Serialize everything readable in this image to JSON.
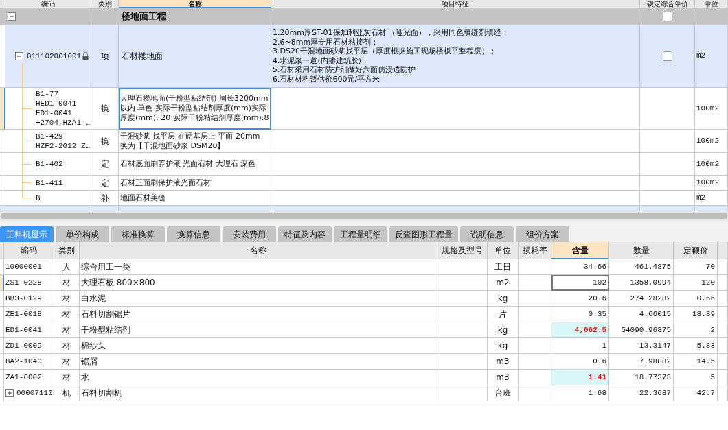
{
  "upper_table": {
    "columns": [
      {
        "label": "编码",
        "selected": false
      },
      {
        "label": "类别",
        "selected": false
      },
      {
        "label": "名称",
        "selected": true
      },
      {
        "label": "项目特征",
        "selected": false
      },
      {
        "label": "锁定综合单价",
        "selected": false
      },
      {
        "label": "单位",
        "selected": false
      }
    ],
    "rows": [
      {
        "kind": "group",
        "expanded": true,
        "name": "楼地面工程",
        "lock_checked": false,
        "children": [
          {
            "kind": "item",
            "code": "011102001001",
            "locked": true,
            "expanded": true,
            "type": "项",
            "name": "石材楼地面",
            "features": [
              "1.20mm厚ST-01保加利亚灰石材 （哑光面），采用同色填缝剂填缝；",
              "2.6~8mm厚专用石材粘接剂；",
              "3.DS20干混地面砂浆找平层（厚度根据施工现场楼板平整程度）；",
              "4.水泥浆一道(内掺建筑胶)；",
              "5.石材采用石材防护剂做好六面仿浸透防护",
              "6.石材材料暂估价600元/平方米"
            ],
            "lock_checked": false,
            "unit": "m2",
            "children": [
              {
                "kind": "sub",
                "code": [
                  "B1-77",
                  "HED1-0041",
                  "ED1-0041",
                  "+2704,HZA1-…"
                ],
                "type": "换",
                "name": "大理石楼地面(干粉型粘结剂) 周长3200mm以内 单色  实际干粉型粘结剂厚度(mm)实际厚度(mm): 20  实际干粉粘结剂厚度(mm):8",
                "unit": "100m2",
                "selected": true
              },
              {
                "kind": "sub",
                "code": [
                  "B1-429",
                  "HZF2-2012 Z…"
                ],
                "type": "换",
                "name": "干混砂浆 找平层 在硬基层上 平面 20mm 换为【干混地面砂浆 DSM20】",
                "unit": "100m2",
                "selected": false
              },
              {
                "kind": "sub",
                "code": [
                  "B1-402"
                ],
                "type": "定",
                "name": "石材底面刷养护液 光面石材 大理石 深色",
                "unit": "100m2",
                "selected": false
              },
              {
                "kind": "sub",
                "code": [
                  "B1-411"
                ],
                "type": "定",
                "name": "石材正面刷保护液光面石材",
                "unit": "100m2",
                "selected": false
              },
              {
                "kind": "sub",
                "code": [
                  "B"
                ],
                "type": "补",
                "name": "地面石材美缝",
                "unit": "m2",
                "selected": false
              }
            ]
          }
        ]
      }
    ]
  },
  "tabs": [
    {
      "label": "工料机显示",
      "selected": true
    },
    {
      "label": "单价构成",
      "selected": false
    },
    {
      "label": "标准换算",
      "selected": false
    },
    {
      "label": "换算信息",
      "selected": false
    },
    {
      "label": "安装费用",
      "selected": false
    },
    {
      "label": "特征及内容",
      "selected": false
    },
    {
      "label": "工程量明细",
      "selected": false
    },
    {
      "label": "反查图形工程量",
      "selected": false
    },
    {
      "label": "说明信息",
      "selected": false
    },
    {
      "label": "组价方案",
      "selected": false
    }
  ],
  "lower_table": {
    "columns": [
      {
        "label": "编码",
        "selected": false
      },
      {
        "label": "类别",
        "selected": false
      },
      {
        "label": "名称",
        "selected": false
      },
      {
        "label": "规格及型号",
        "selected": false
      },
      {
        "label": "单位",
        "selected": false
      },
      {
        "label": "损耗率",
        "selected": false
      },
      {
        "label": "含量",
        "selected": true
      },
      {
        "label": "数量",
        "selected": false
      },
      {
        "label": "定额价",
        "selected": false
      }
    ],
    "rows": [
      {
        "code": "10000001",
        "type": "人",
        "name": "综合用工一类",
        "unit": "工日",
        "content": "34.66",
        "quantity": "461.4875",
        "price": "70",
        "modified": false,
        "selected": false,
        "has_children": false
      },
      {
        "code": "ZS1-0228",
        "type": "材",
        "name": "大理石板 800×800",
        "unit": "m2",
        "content": "102",
        "quantity": "1358.0994",
        "price": "120",
        "modified": false,
        "selected": true,
        "has_children": false
      },
      {
        "code": "BB3-0129",
        "type": "材",
        "name": "白水泥",
        "unit": "kg",
        "content": "20.6",
        "quantity": "274.28282",
        "price": "0.66",
        "modified": false,
        "selected": false,
        "has_children": false
      },
      {
        "code": "ZE1-0018",
        "type": "材",
        "name": "石料切割锯片",
        "unit": "片",
        "content": "0.35",
        "quantity": "4.66015",
        "price": "18.89",
        "modified": false,
        "selected": false,
        "has_children": false
      },
      {
        "code": "ED1-0041",
        "type": "材",
        "name": "干粉型粘结剂",
        "unit": "kg",
        "content": "4,062.5",
        "quantity": "54090.96875",
        "price": "2",
        "modified": true,
        "selected": false,
        "has_children": false
      },
      {
        "code": "ZD1-0009",
        "type": "材",
        "name": "棉纱头",
        "unit": "kg",
        "content": "1",
        "quantity": "13.3147",
        "price": "5.83",
        "modified": false,
        "selected": false,
        "has_children": false
      },
      {
        "code": "BA2-1040",
        "type": "材",
        "name": "锯屑",
        "unit": "m3",
        "content": "0.6",
        "quantity": "7.98882",
        "price": "14.5",
        "modified": false,
        "selected": false,
        "has_children": false
      },
      {
        "code": "ZA1-0002",
        "type": "材",
        "name": "水",
        "unit": "m3",
        "content": "1.41",
        "quantity": "18.77373",
        "price": "5",
        "modified": true,
        "selected": false,
        "has_children": false
      },
      {
        "code": "00007110",
        "type": "机",
        "name": "石料切割机",
        "unit": "台班",
        "content": "1.68",
        "quantity": "22.3687",
        "price": "42.7",
        "modified": false,
        "selected": false,
        "has_children": true
      }
    ]
  }
}
